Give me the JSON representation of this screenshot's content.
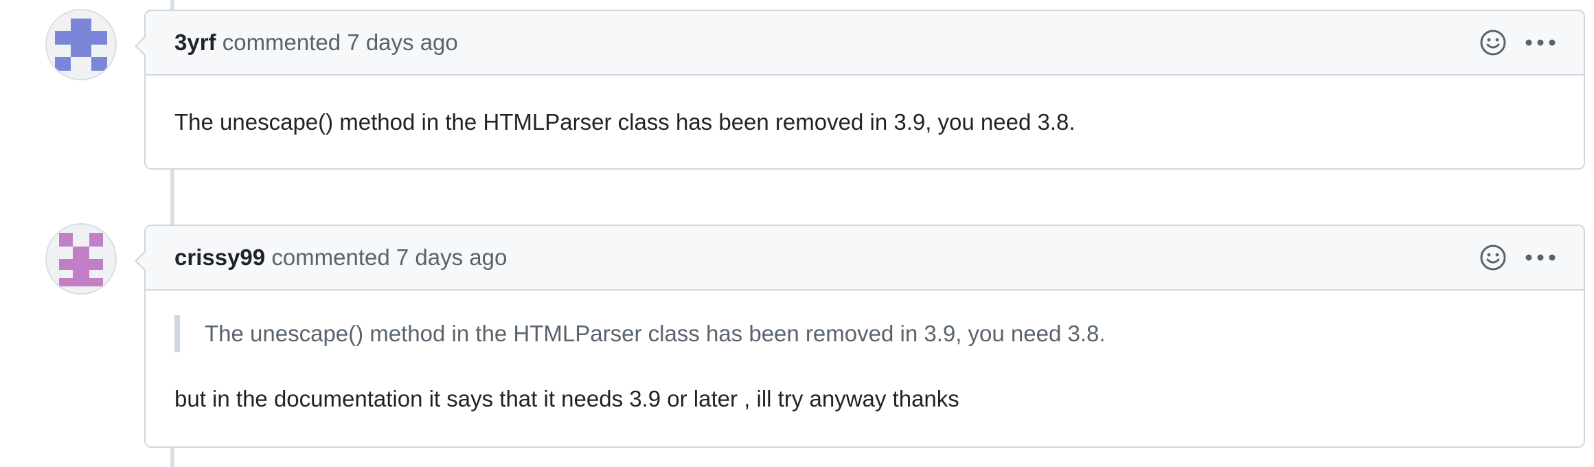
{
  "comments": [
    {
      "author": "3yrf",
      "action": "commented",
      "time": "7 days ago",
      "avatar_color": "#7b86d8",
      "body": "The unescape() method in the HTMLParser class has been removed in 3.9, you need 3.8.",
      "reaction_icon": "smiley-icon",
      "menu_icon": "kebab-horizontal-icon"
    },
    {
      "author": "crissy99",
      "action": "commented",
      "time": "7 days ago",
      "avatar_color": "#c17fc7",
      "quote": "The unescape() method in the HTMLParser class has been removed in 3.9, you need 3.8.",
      "body": "but in the documentation it says that it needs 3.9 or later , ill try anyway thanks",
      "reaction_icon": "smiley-icon",
      "menu_icon": "kebab-horizontal-icon"
    }
  ]
}
